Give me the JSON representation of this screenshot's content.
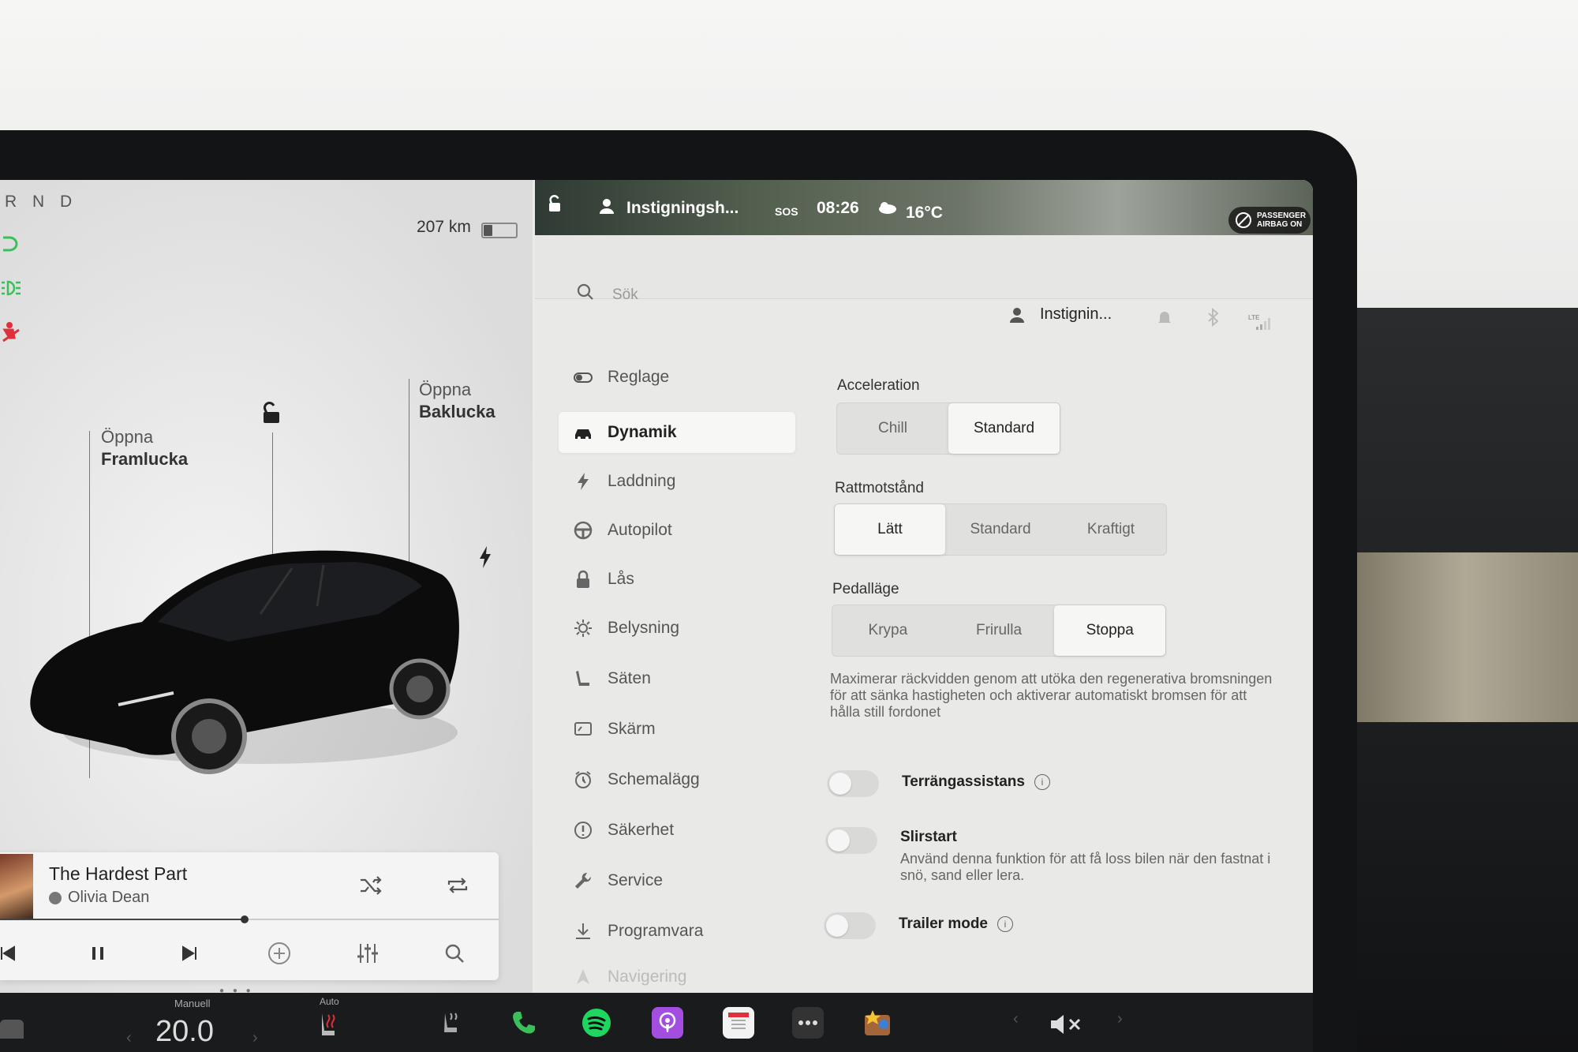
{
  "car_panel": {
    "gear": "R N D",
    "range": "207 km",
    "battery_level": 0.25,
    "front_trunk": {
      "line1": "Öppna",
      "line2": "Framlucka"
    },
    "rear_trunk": {
      "line1": "Öppna",
      "line2": "Baklucka"
    }
  },
  "music": {
    "title": "The Hardest Part",
    "artist": "Olivia Dean",
    "progress": 0.49,
    "controls": [
      "previous-icon",
      "pause-icon",
      "next-icon",
      "add-icon",
      "equalizer-icon",
      "search-icon"
    ]
  },
  "status_bar": {
    "profile": "Instigningsh...",
    "sos": "SOS",
    "time": "08:26",
    "temperature": "16°C",
    "airbag_line1": "PASSENGER",
    "airbag_line2": "AIRBAG ON"
  },
  "search": {
    "placeholder": "Sök"
  },
  "profile_row": {
    "name": "Instignin...",
    "lte": "LTE"
  },
  "menu": {
    "items": [
      {
        "label": "Reglage",
        "icon": "toggle-icon"
      },
      {
        "label": "Dynamik",
        "icon": "car-icon",
        "active": true
      },
      {
        "label": "Laddning",
        "icon": "bolt-icon"
      },
      {
        "label": "Autopilot",
        "icon": "steering-wheel-icon"
      },
      {
        "label": "Lås",
        "icon": "lock-icon"
      },
      {
        "label": "Belysning",
        "icon": "sun-icon"
      },
      {
        "label": "Säten",
        "icon": "seat-icon"
      },
      {
        "label": "Skärm",
        "icon": "display-icon"
      },
      {
        "label": "Schemalägg",
        "icon": "alarm-icon"
      },
      {
        "label": "Säkerhet",
        "icon": "alert-icon"
      },
      {
        "label": "Service",
        "icon": "wrench-icon"
      },
      {
        "label": "Programvara",
        "icon": "download-icon"
      },
      {
        "label": "Navigering",
        "icon": "navigation-icon"
      }
    ]
  },
  "dynamics": {
    "acceleration": {
      "label": "Acceleration",
      "options": [
        "Chill",
        "Standard"
      ],
      "selected": "Standard"
    },
    "steering": {
      "label": "Rattmotstånd",
      "options": [
        "Lätt",
        "Standard",
        "Kraftigt"
      ],
      "selected": "Lätt"
    },
    "pedal": {
      "label": "Pedalläge",
      "options": [
        "Krypa",
        "Frirulla",
        "Stoppa"
      ],
      "selected": "Stoppa"
    },
    "pedal_description": "Maximerar räckvidden genom att utöka den regenerativa bromsningen för att sänka hastigheten och aktiverar automatiskt bromsen för att hålla still fordonet",
    "toggles": [
      {
        "label": "Terrängassistans",
        "on": false,
        "info": true
      },
      {
        "label": "Slirstart",
        "on": false,
        "description": "Använd denna funktion för att få loss bilen när den fastnat i snö, sand eller lera."
      },
      {
        "label": "Trailer mode",
        "on": false,
        "info": true
      }
    ]
  },
  "dock": {
    "climate_mode": "Manuell",
    "temperature": "20.0",
    "seat_heat_mode": "Auto",
    "apps": [
      "fan-icon",
      "phone-icon",
      "spotify-icon",
      "podcasts-icon",
      "calendar-icon",
      "more-icon",
      "games-icon"
    ],
    "volume": "mute-icon"
  },
  "colors": {
    "green": "#3bbf5a",
    "spotify": "#1ed760",
    "podcasts": "#a34ee0",
    "red": "#e0303b"
  }
}
